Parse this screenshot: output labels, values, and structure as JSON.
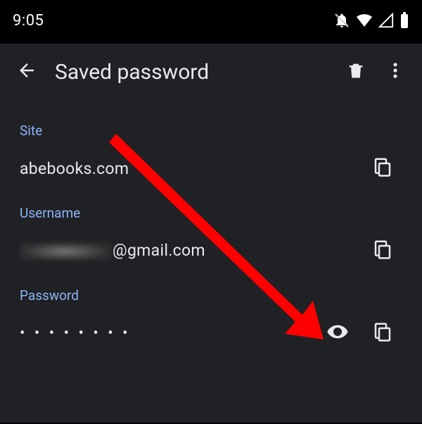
{
  "status": {
    "time": "9:05"
  },
  "header": {
    "title": "Saved password"
  },
  "fields": {
    "site": {
      "label": "Site",
      "value": "abebooks.com"
    },
    "username": {
      "label": "Username",
      "suffix": "@gmail.com"
    },
    "password": {
      "label": "Password",
      "masked": "• • • • • • • •"
    }
  }
}
